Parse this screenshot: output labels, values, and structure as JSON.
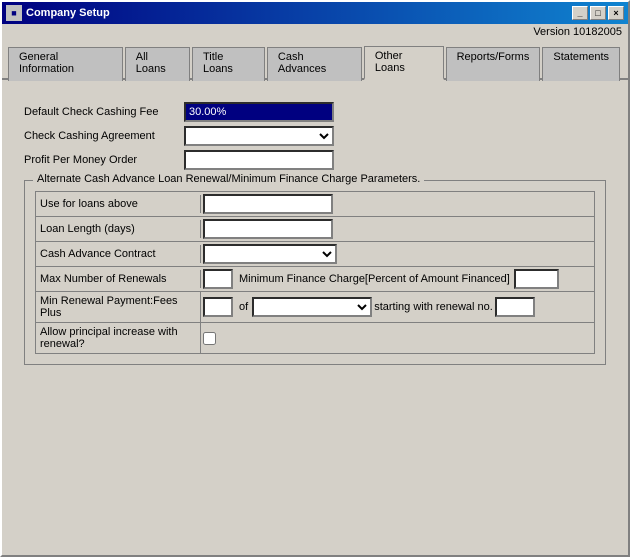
{
  "window": {
    "title": "Company Setup",
    "version": "Version 10182005",
    "min_btn": "_",
    "max_btn": "□",
    "close_btn": "×"
  },
  "tabs": [
    {
      "id": "general",
      "label": "General Information",
      "active": false
    },
    {
      "id": "all-loans",
      "label": "All Loans",
      "active": false
    },
    {
      "id": "title-loans",
      "label": "Title Loans",
      "active": false
    },
    {
      "id": "cash-advances",
      "label": "Cash Advances",
      "active": false
    },
    {
      "id": "other-loans",
      "label": "Other Loans",
      "active": true
    },
    {
      "id": "reports-forms",
      "label": "Reports/Forms",
      "active": false
    },
    {
      "id": "statements",
      "label": "Statements",
      "active": false
    }
  ],
  "form": {
    "default_check_cashing_fee_label": "Default Check Cashing Fee",
    "default_check_cashing_fee_value": "30.00%",
    "check_cashing_agreement_label": "Check Cashing Agreement",
    "check_cashing_agreement_value": "",
    "profit_per_money_order_label": "Profit Per Money Order",
    "profit_per_money_order_value": ""
  },
  "group": {
    "title": "Alternate Cash Advance Loan Renewal/Minimum Finance Charge Parameters.",
    "use_for_loans_above_label": "Use for loans above",
    "use_for_loans_above_value": "",
    "loan_length_days_label": "Loan Length (days)",
    "loan_length_days_value": "",
    "cash_advance_contract_label": "Cash Advance Contract",
    "cash_advance_contract_value": "",
    "max_renewals_label": "Max Number of Renewals",
    "max_renewals_value": "",
    "mfc_label": "Minimum Finance Charge[Percent of Amount Financed]",
    "mfc_value": "",
    "min_renewal_label": "Min Renewal Payment:Fees Plus",
    "min_renewal_value": "",
    "of_label": "of",
    "renewal_select_value": "",
    "starting_label": "starting with renewal no.",
    "starting_value": "",
    "allow_principal_label": "Allow principal increase with renewal?",
    "allow_principal_checked": false
  }
}
